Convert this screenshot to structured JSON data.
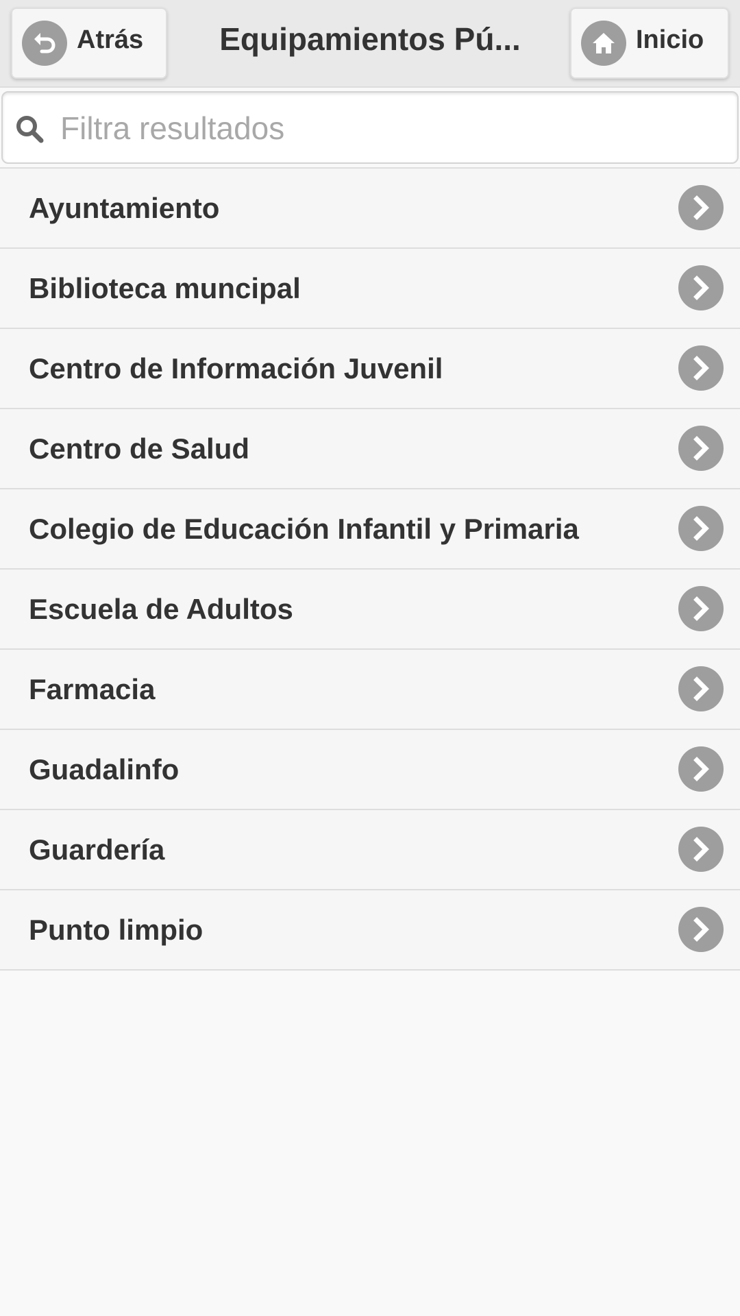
{
  "header": {
    "back_label": "Atrás",
    "back_icon": "undo-arrow-icon",
    "title": "Equipamientos Pú...",
    "home_label": "Inicio",
    "home_icon": "home-icon"
  },
  "search": {
    "placeholder": "Filtra resultados",
    "value": "",
    "icon": "search-icon"
  },
  "list": {
    "item_icon": "chevron-right-icon",
    "items": [
      {
        "label": "Ayuntamiento"
      },
      {
        "label": "Biblioteca muncipal"
      },
      {
        "label": "Centro de Información Juvenil"
      },
      {
        "label": "Centro de Salud"
      },
      {
        "label": "Colegio de Educación Infantil y Primaria"
      },
      {
        "label": "Escuela de Adultos"
      },
      {
        "label": "Farmacia"
      },
      {
        "label": "Guadalinfo"
      },
      {
        "label": "Guardería"
      },
      {
        "label": "Punto limpio"
      }
    ]
  },
  "colors": {
    "header_bg": "#e9e9e9",
    "row_bg": "#f6f6f6",
    "text": "#333333",
    "icon_disc": "#9e9e9e",
    "placeholder": "#a8a8a8"
  }
}
